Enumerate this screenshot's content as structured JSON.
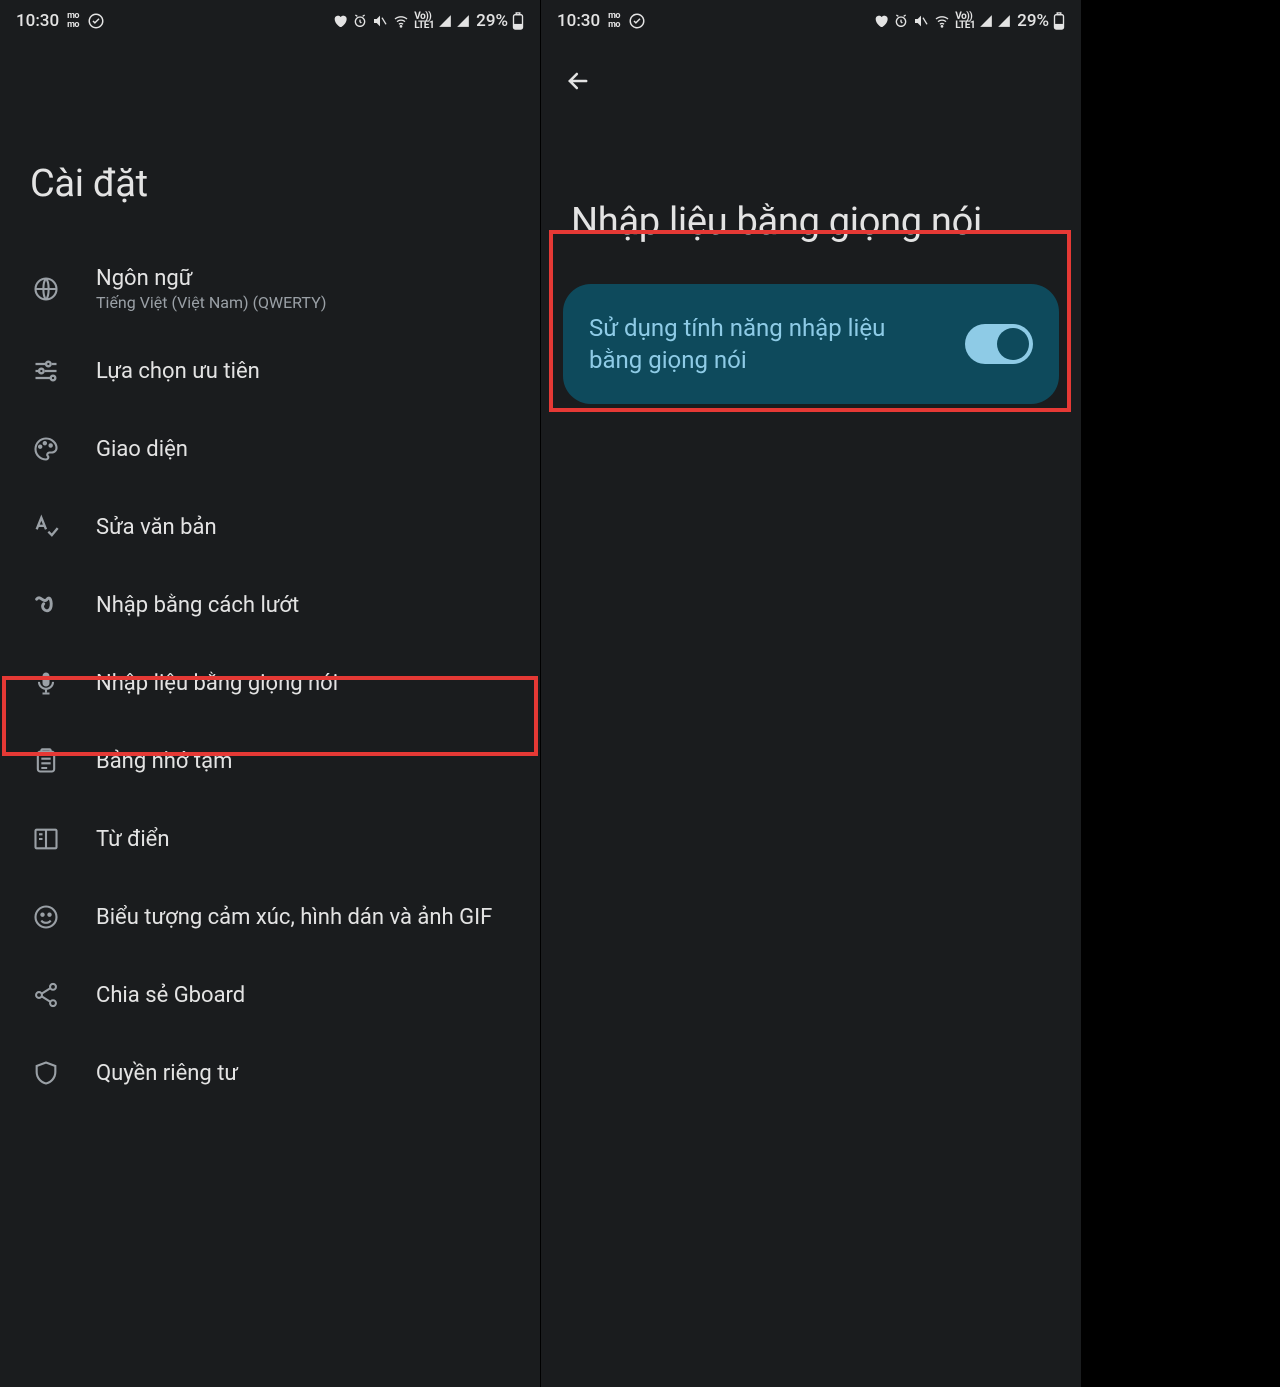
{
  "status": {
    "time": "10:30",
    "momo_top": "mo",
    "momo_bot": "mo",
    "battery": "29%",
    "volte_top": "Vo))",
    "volte_bot": "LTE1"
  },
  "left": {
    "title": "Cài đặt",
    "items": [
      {
        "label": "Ngôn ngữ",
        "sublabel": "Tiếng Việt (Việt Nam) (QWERTY)",
        "icon": "globe"
      },
      {
        "label": "Lựa chọn ưu tiên",
        "icon": "tune"
      },
      {
        "label": "Giao diện",
        "icon": "palette"
      },
      {
        "label": "Sửa văn bản",
        "icon": "spellcheck"
      },
      {
        "label": "Nhập bằng cách lướt",
        "icon": "gesture"
      },
      {
        "label": "Nhập liệu bằng giọng nói",
        "icon": "mic",
        "highlighted": true
      },
      {
        "label": "Bảng nhớ tạm",
        "icon": "clipboard"
      },
      {
        "label": "Từ điển",
        "icon": "book"
      },
      {
        "label": "Biểu tượng cảm xúc, hình dán và ảnh GIF",
        "icon": "emoji"
      },
      {
        "label": "Chia sẻ Gboard",
        "icon": "share"
      },
      {
        "label": "Quyền riêng tư",
        "icon": "privacy"
      }
    ]
  },
  "right": {
    "title": "Nhập liệu bằng giọng nói",
    "toggle_label": "Sử dụng tính năng nhập liệu bằng giọng nói",
    "toggle_on": true
  }
}
